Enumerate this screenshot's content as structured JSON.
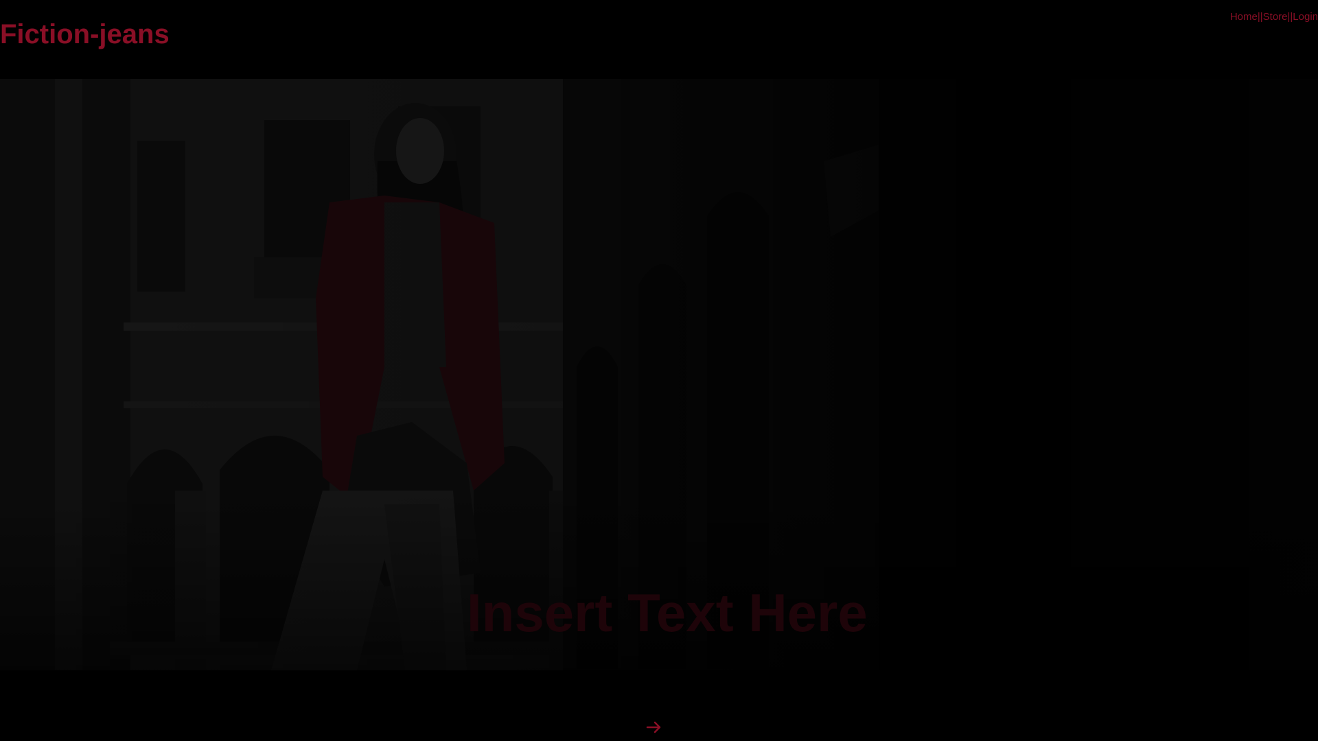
{
  "brand": {
    "logo_text": "Fiction-jeans",
    "accent_color": "#8a0f26"
  },
  "nav": {
    "items": [
      {
        "label": "Home"
      },
      {
        "label": "Store"
      },
      {
        "label": "Login"
      }
    ],
    "separator": "||"
  },
  "hero": {
    "caption": "Insert Text Here"
  },
  "slider": {
    "next_icon": "arrow-right-icon"
  }
}
